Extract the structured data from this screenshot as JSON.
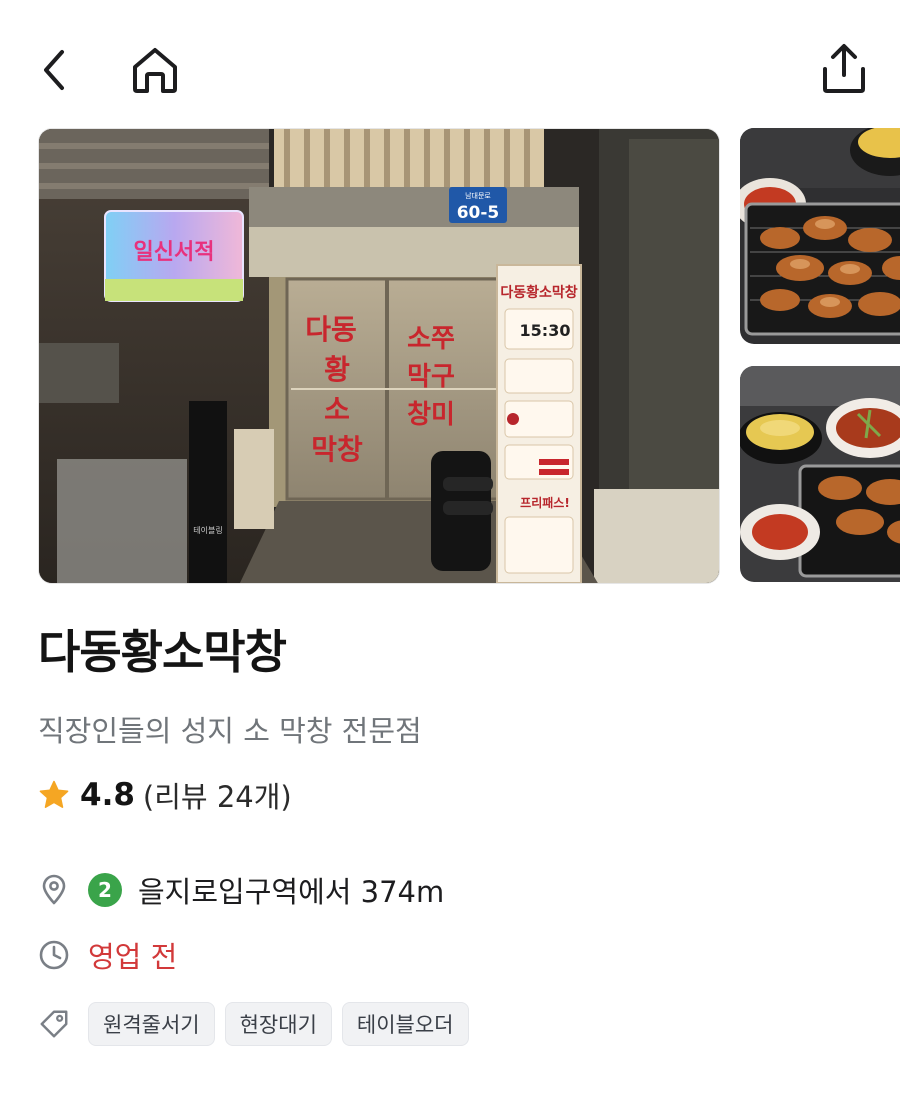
{
  "header": {
    "back_icon": "chevron-left-icon",
    "home_icon": "home-icon",
    "share_icon": "share-icon"
  },
  "gallery": {
    "main_photo": {
      "sign_rainbow": "일신서적",
      "address_plate_top": "남대문로",
      "address_plate_number": "60-5",
      "door_left": "다동황소막창",
      "door_right": "소쭈막구창미",
      "stand_title": "다동황소막창",
      "stand_time": "15:30",
      "stand_free_pass": "프리패스!"
    }
  },
  "place": {
    "name": "다동황소막창",
    "description": "직장인들의 성지 소 막창 전문점",
    "rating": "4.8",
    "review_count": "(리뷰 24개)",
    "location": {
      "line_number": "2",
      "line_color": "#3aa44a",
      "text": "을지로입구역에서 374m"
    },
    "hours_status": "영업 전",
    "hours_color": "#d2393a",
    "tags": [
      "원격줄서기",
      "현장대기",
      "테이블오더"
    ]
  },
  "colors": {
    "star": "#f5a623",
    "icon_gray": "#7a7f86"
  }
}
